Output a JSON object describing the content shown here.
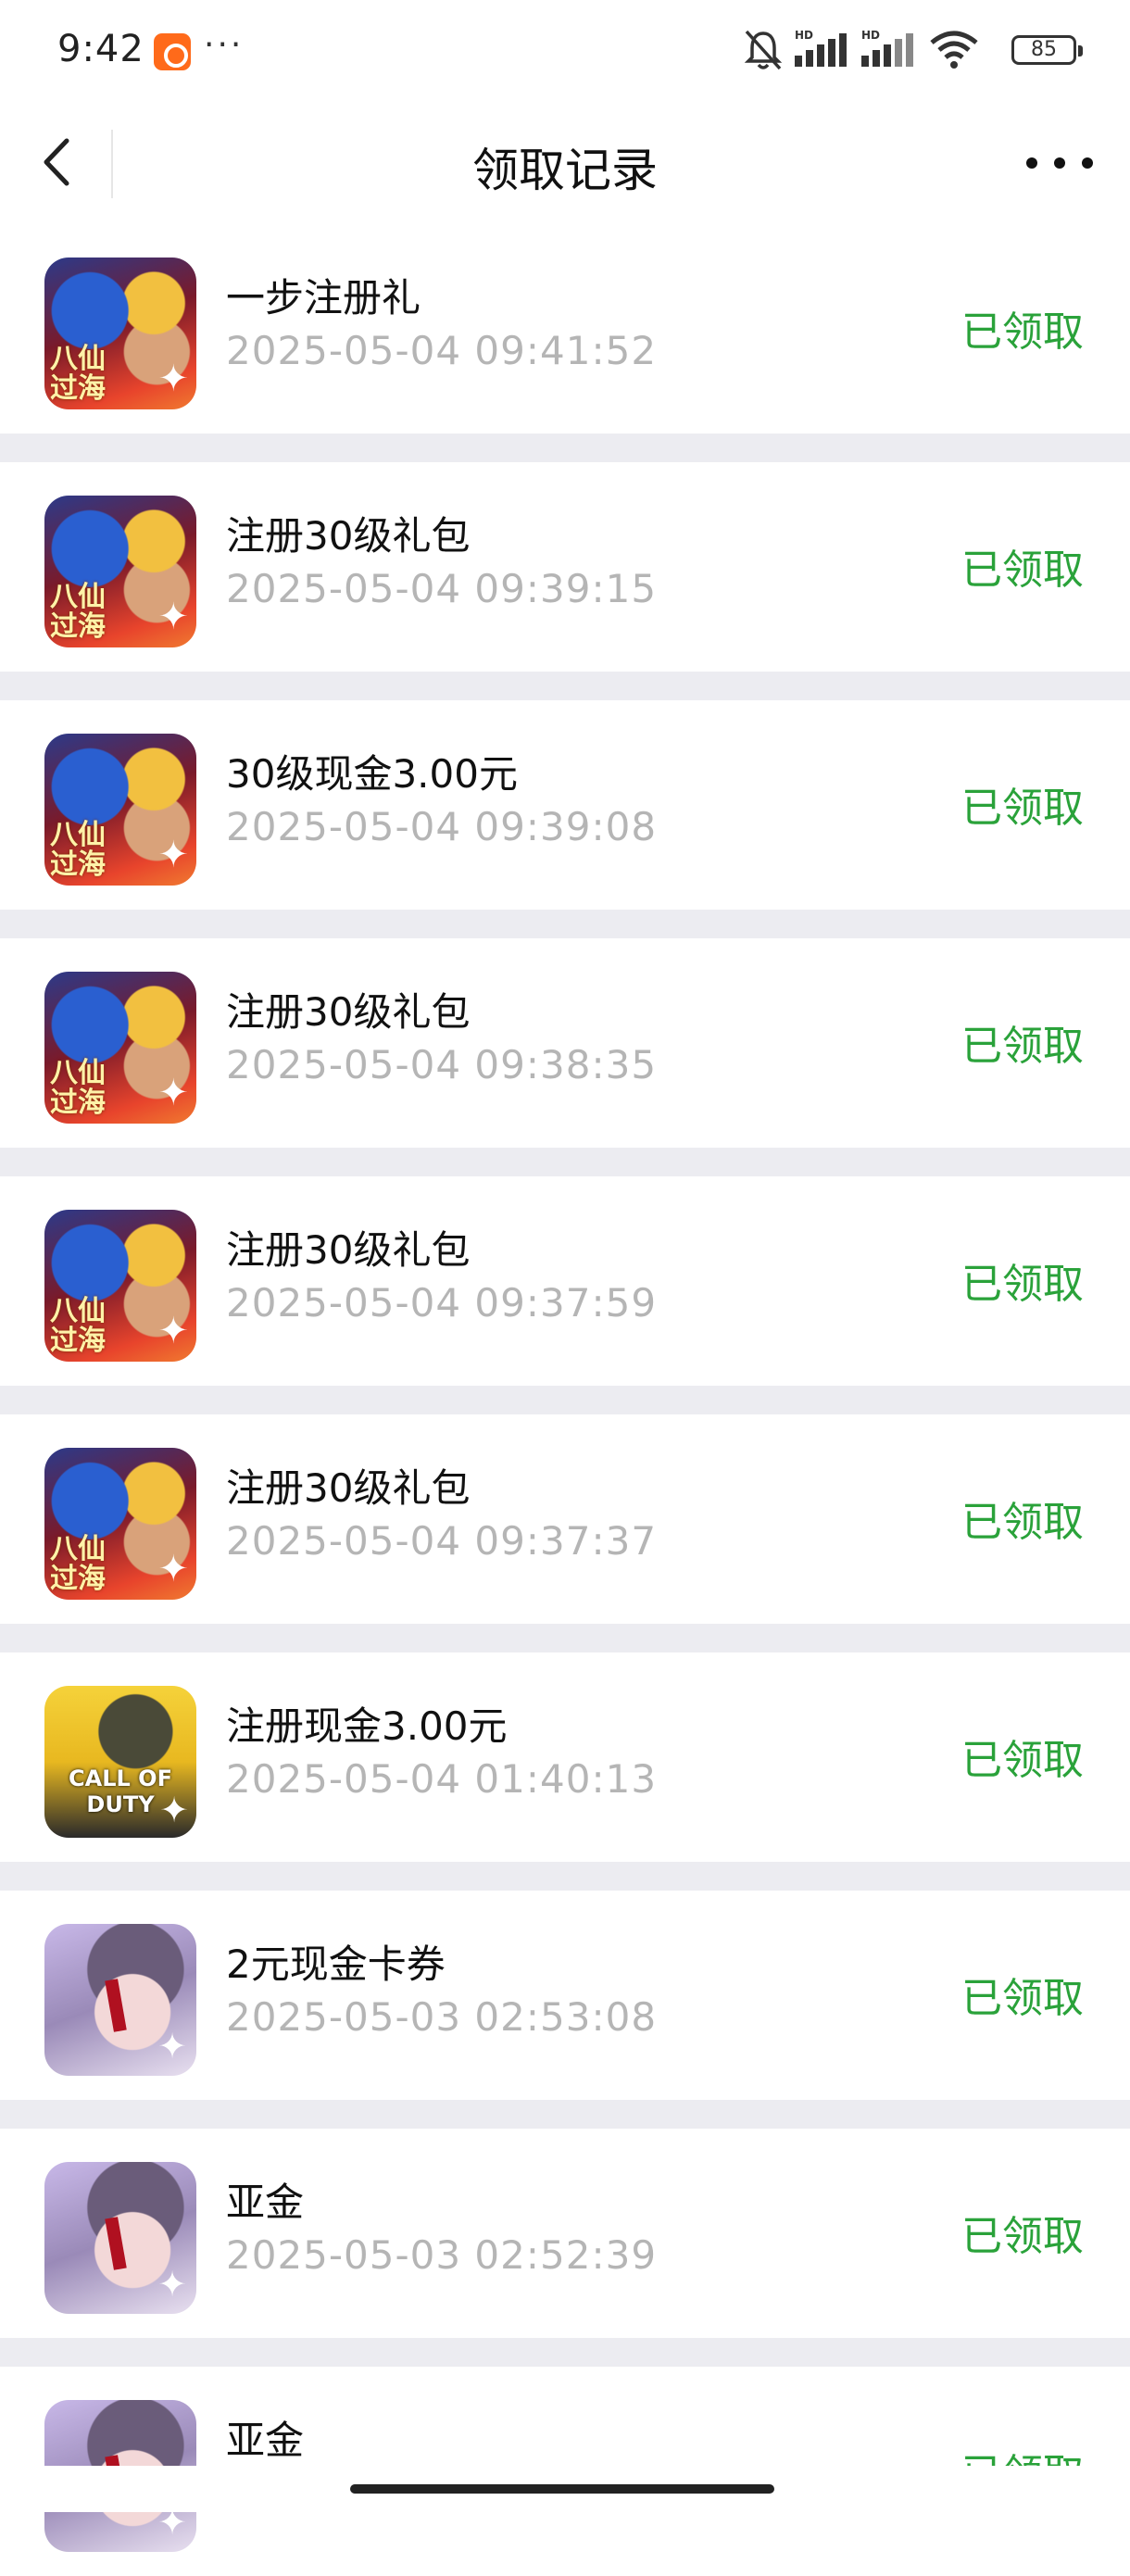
{
  "status_bar": {
    "time": "9:42",
    "more": "···",
    "battery": "85",
    "hd1": "HD",
    "hd2": "HD"
  },
  "nav": {
    "title": "领取记录"
  },
  "colors": {
    "claimed_green": "#2aa23a",
    "timestamp_gray": "#b5b5b5",
    "separator": "#ececf1"
  },
  "records": [
    {
      "icon": "baxian-game-icon",
      "name": "一步注册礼",
      "time": "2025-05-04 09:41:52",
      "status": "已领取"
    },
    {
      "icon": "baxian-game-icon",
      "name": "注册30级礼包",
      "time": "2025-05-04 09:39:15",
      "status": "已领取"
    },
    {
      "icon": "baxian-game-icon",
      "name": "30级现金3.00元",
      "time": "2025-05-04 09:39:08",
      "status": "已领取"
    },
    {
      "icon": "baxian-game-icon",
      "name": "注册30级礼包",
      "time": "2025-05-04 09:38:35",
      "status": "已领取"
    },
    {
      "icon": "baxian-game-icon",
      "name": "注册30级礼包",
      "time": "2025-05-04 09:37:59",
      "status": "已领取"
    },
    {
      "icon": "baxian-game-icon",
      "name": "注册30级礼包",
      "time": "2025-05-04 09:37:37",
      "status": "已领取"
    },
    {
      "icon": "call-of-duty-icon",
      "name": "注册现金3.00元",
      "time": "2025-05-04 01:40:13",
      "status": "已领取"
    },
    {
      "icon": "girl-game-icon",
      "name": "2元现金卡券",
      "time": "2025-05-03 02:53:08",
      "status": "已领取"
    },
    {
      "icon": "girl-game-icon",
      "name": "亚金",
      "time": "2025-05-03 02:52:39",
      "status": "已领取"
    },
    {
      "icon": "girl-game-icon",
      "name": "亚金",
      "time": "",
      "status": "已领取"
    }
  ],
  "icon_text": {
    "baxian": "八仙\n过海",
    "cod": "CALL OF DUTY"
  }
}
